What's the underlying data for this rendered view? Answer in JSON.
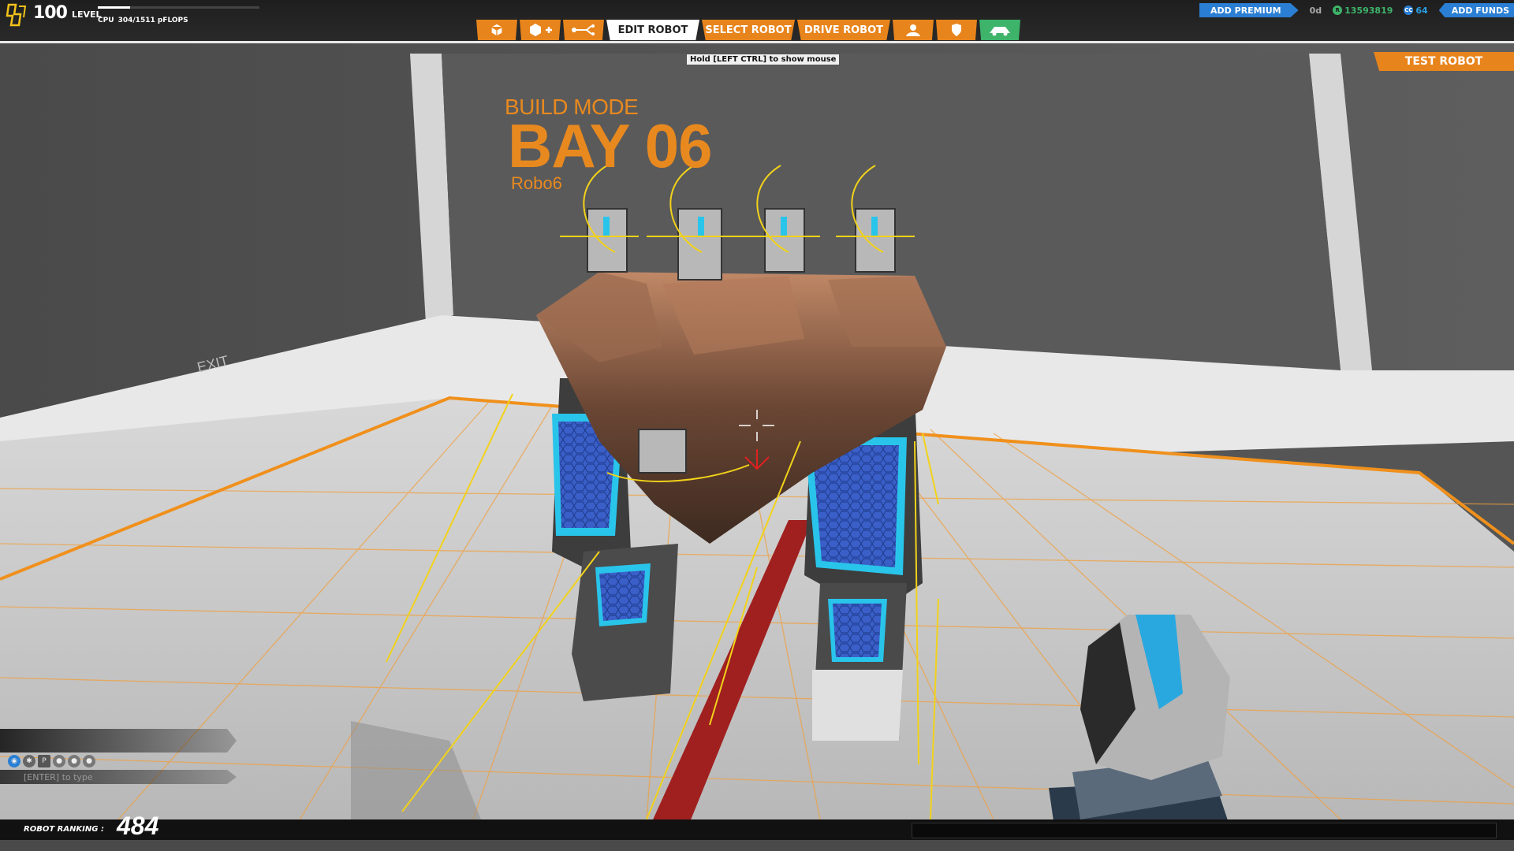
{
  "player": {
    "level": "100",
    "level_label": "LEVEL",
    "cpu_label": "CPU",
    "cpu_text": "304/1511 pFLOPS",
    "cpu_used": 304,
    "cpu_max": 1511
  },
  "nav": {
    "build_icon": "cube-icon",
    "add_icon": "cube-plus-icon",
    "connect_icon": "connect-icon",
    "edit_label": "EDIT ROBOT",
    "select_label": "SELECT ROBOT",
    "drive_label": "DRIVE ROBOT",
    "player_icon": "player-icon",
    "shield_icon": "shield-icon",
    "garage_icon": "garage-icon"
  },
  "hint": "Hold [LEFT CTRL] to show mouse",
  "currency": {
    "premium_label": "ADD PREMIUM",
    "premium_days": "0d",
    "robits": "13593819",
    "cosmetic_credits": "64",
    "funds_label": "ADD FUNDS"
  },
  "test_label": "TEST ROBOT",
  "bay": {
    "mode": "BUILD MODE",
    "number": "BAY 06",
    "robot_name": "Robo6"
  },
  "exit_label": "EXIT",
  "chat": {
    "placeholder": "[ENTER] to type",
    "channel_icons": [
      "globe-icon",
      "clan-icon",
      "party-icon",
      "friend-icon",
      "friend-icon",
      "friend-icon"
    ],
    "party_letter": "P"
  },
  "ranking": {
    "label": "ROBOT RANKING :",
    "value": "484"
  },
  "colors": {
    "accent": "#e8841c",
    "premium_blue": "#2a7fd4",
    "robits_green": "#3eb36a",
    "grid_orange": "#f0a040"
  }
}
